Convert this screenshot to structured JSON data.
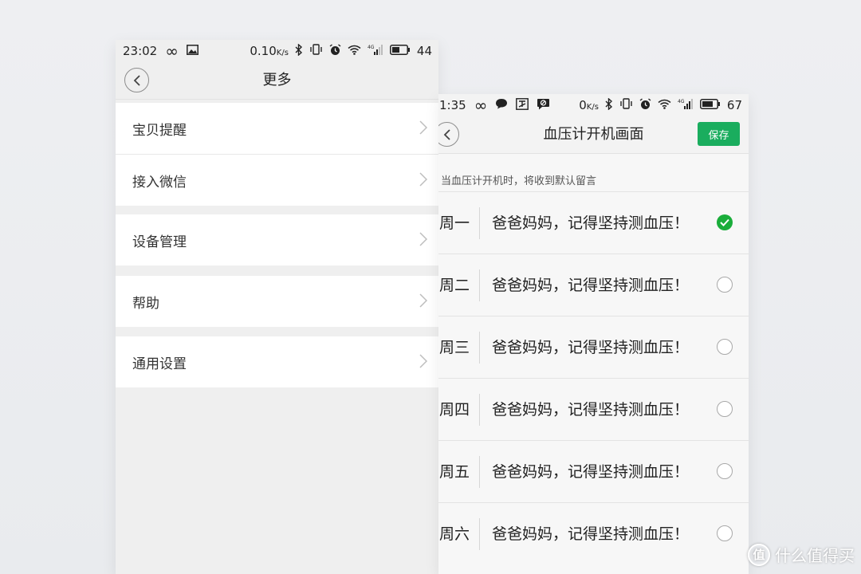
{
  "left_screen": {
    "status": {
      "time": "23:02",
      "speed": "0.10",
      "speed_unit": "K/s",
      "battery": "44"
    },
    "title": "更多",
    "menu_items": [
      {
        "label": "宝贝提醒"
      },
      {
        "label": "接入微信"
      },
      {
        "label": "设备管理"
      },
      {
        "label": "帮助"
      },
      {
        "label": "通用设置"
      }
    ]
  },
  "right_screen": {
    "status": {
      "time": "1:35",
      "speed": "0",
      "speed_unit": "K/s",
      "battery": "67"
    },
    "title": "血压计开机画面",
    "save_label": "保存",
    "hint": "当血压计开机时，将收到默认留言",
    "rows": [
      {
        "day": "周一",
        "message": "爸爸妈妈，记得坚持测血压！",
        "selected": true
      },
      {
        "day": "周二",
        "message": "爸爸妈妈，记得坚持测血压！",
        "selected": false
      },
      {
        "day": "周三",
        "message": "爸爸妈妈，记得坚持测血压！",
        "selected": false
      },
      {
        "day": "周四",
        "message": "爸爸妈妈，记得坚持测血压！",
        "selected": false
      },
      {
        "day": "周五",
        "message": "爸爸妈妈，记得坚持测血压！",
        "selected": false
      },
      {
        "day": "周六",
        "message": "爸爸妈妈，记得坚持测血压！",
        "selected": false
      }
    ]
  },
  "watermark": {
    "logo_char": "值",
    "text": "什么值得买"
  },
  "colors": {
    "accent_green": "#1aad5e",
    "check_green": "#1aad3a"
  }
}
